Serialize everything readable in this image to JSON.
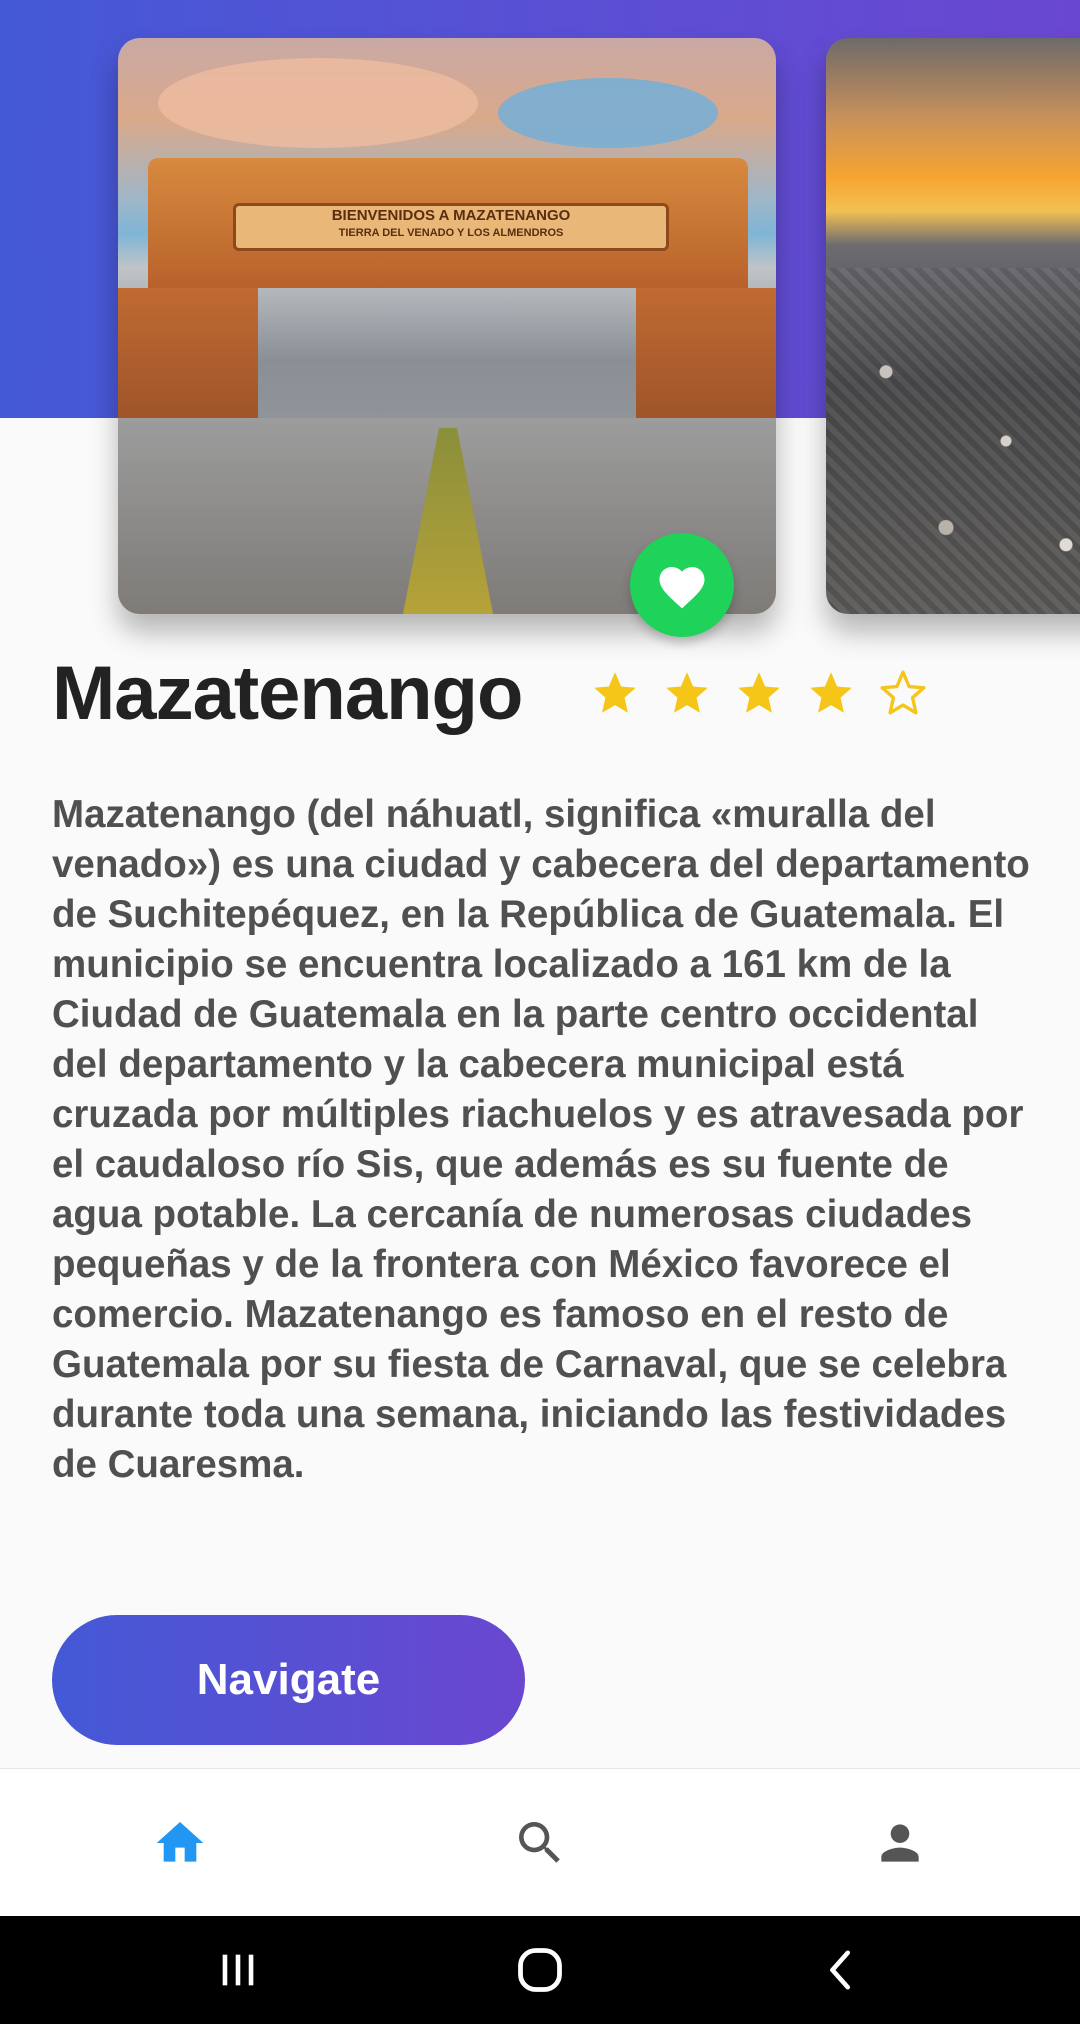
{
  "place": {
    "title": "Mazatenango",
    "rating": 4,
    "rating_max": 5,
    "description": "Mazatenango (del náhuatl, significa «muralla del venado») es una ciudad y cabecera del departamento de Suchitepéquez, en la República de Guatemala. El municipio se encuentra localizado a 161 km de la Ciudad de Guatemala en la parte centro occidental del departamento y la cabecera municipal está cruzada por múltiples riachuelos y es atravesada por el caudaloso río Sis, que además es su fuente de agua potable. La cercanía de numerosas ciudades pequeñas y de la frontera con México favorece el comercio. Mazatenango es famoso en el resto de Guatemala por su fiesta de Carnaval, que se celebra durante toda una semana, iniciando las festividades de Cuaresma."
  },
  "gallery": {
    "main_image": {
      "sign_line1": "BIENVENIDOS A MAZATENANGO",
      "sign_line2": "TIERRA DEL VENADO Y LOS ALMENDROS"
    },
    "favorite": {
      "icon": "heart-icon",
      "color": "#1fd25a",
      "active": true
    }
  },
  "actions": {
    "navigate_label": "Navigate"
  },
  "bottom_nav": {
    "items": [
      {
        "icon": "home-icon",
        "active": true
      },
      {
        "icon": "search-icon",
        "active": false
      },
      {
        "icon": "person-icon",
        "active": false
      }
    ],
    "active_color": "#2196f3",
    "inactive_color": "#555555"
  },
  "system_nav": {
    "buttons": [
      "recents-icon",
      "home-circle-icon",
      "back-icon"
    ]
  },
  "theme": {
    "gradient_start": "#4459d6",
    "gradient_end": "#6a47d0",
    "star_color": "#f5c518"
  }
}
